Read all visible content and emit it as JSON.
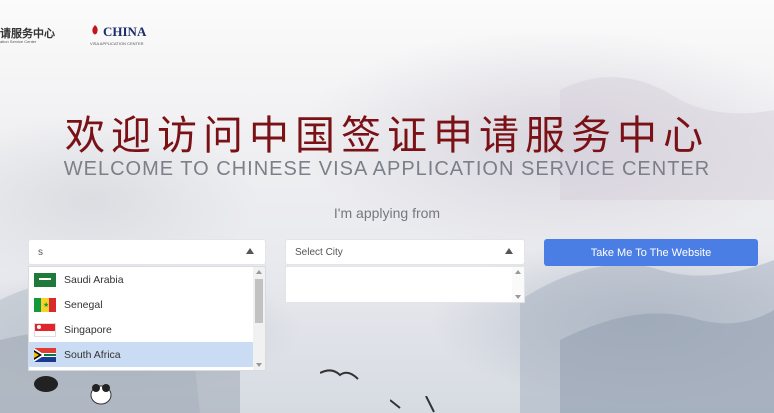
{
  "header": {
    "logo_cn": "请服务中心",
    "logo_sub": "ation Service Center",
    "china_logo": "CHINA",
    "china_sub": "VISA APPLICATION CENTER"
  },
  "hero": {
    "title_cn": "欢迎访问中国签证申请服务中心",
    "title_en": "WELCOME TO CHINESE VISA APPLICATION SERVICE CENTER",
    "applying_label": "I'm applying from"
  },
  "country_select": {
    "value": "s"
  },
  "city_select": {
    "placeholder": "Select City"
  },
  "submit_button": {
    "label": "Take Me To The Website",
    "color": "#4b7ee5"
  },
  "country_dropdown": {
    "items": [
      {
        "label": "Saudi Arabia",
        "flag": "saudi-arabia-flag",
        "selected": false
      },
      {
        "label": "Senegal",
        "flag": "senegal-flag",
        "selected": false
      },
      {
        "label": "Singapore",
        "flag": "singapore-flag",
        "selected": false
      },
      {
        "label": "South Africa",
        "flag": "south-africa-flag",
        "selected": true
      }
    ]
  },
  "colors": {
    "title_cn": "#7a1116",
    "title_en": "#7b7f88",
    "selected_item": "#c9dcf3"
  }
}
